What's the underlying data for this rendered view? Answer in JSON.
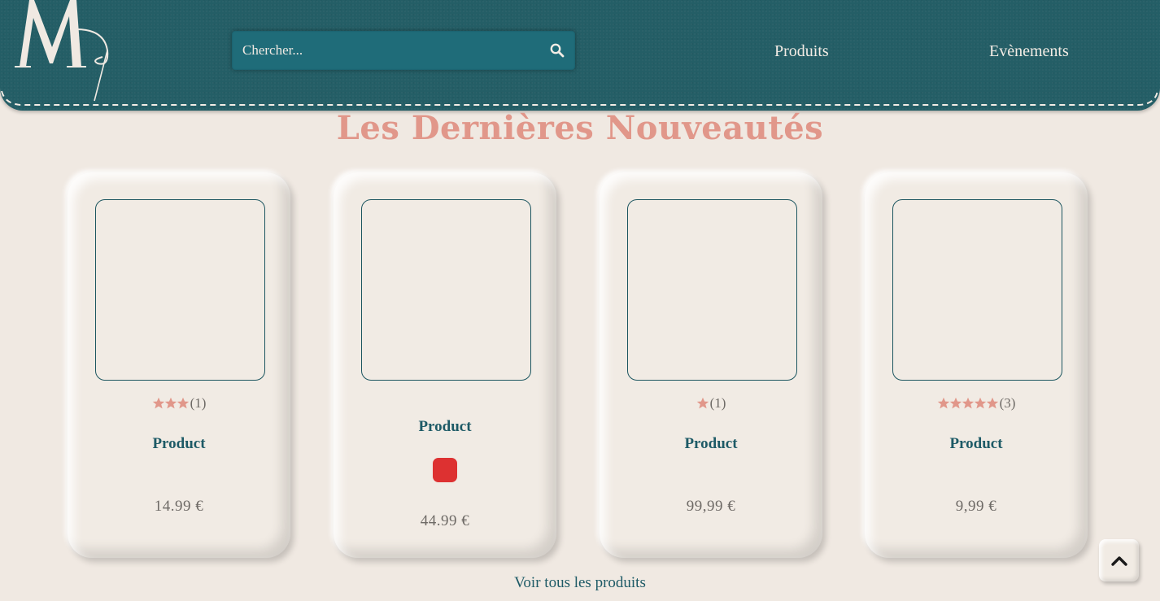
{
  "colors": {
    "header_bg": "#245e66",
    "accent_pink": "#e1978a",
    "teal_text": "#1d5a66",
    "page_bg": "#f0e9e2",
    "swatch_red": "#dd3131"
  },
  "header": {
    "logo_icon": "monogram-logo",
    "search": {
      "placeholder": "Chercher...",
      "icon": "search-icon"
    },
    "nav": [
      {
        "label": "Produits"
      },
      {
        "label": "Evènements"
      }
    ]
  },
  "section": {
    "title": "Les Dernières Nouveautés"
  },
  "products": [
    {
      "name": "Product",
      "price": "14.99 €",
      "rating": 3,
      "reviews": "(1)"
    },
    {
      "name": "Product",
      "price": "44.99 €",
      "color_swatch": "#dd3131"
    },
    {
      "name": "Product",
      "price": "99,99 €",
      "rating": 1,
      "reviews": "(1)"
    },
    {
      "name": "Product",
      "price": "9,99 €",
      "rating": 5,
      "reviews": "(3)"
    }
  ],
  "footer_link": {
    "label": "Voir tous les produits"
  },
  "scroll_top": {
    "icon": "chevron-up-icon"
  }
}
